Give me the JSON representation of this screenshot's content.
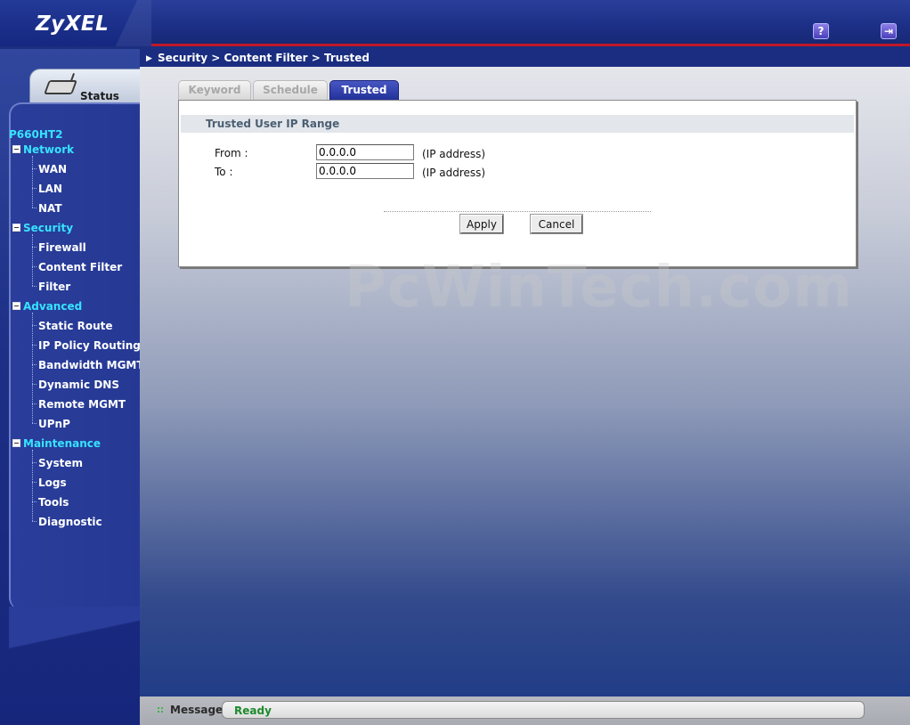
{
  "header": {
    "logo": "ZyXEL",
    "help_icon": "help-icon",
    "logout_icon": "logout-icon"
  },
  "sidebar": {
    "status_label": "Status",
    "model": "P660HT2",
    "groups": [
      {
        "label": "Network",
        "items": [
          "WAN",
          "LAN",
          "NAT"
        ]
      },
      {
        "label": "Security",
        "items": [
          "Firewall",
          "Content Filter",
          "Filter"
        ]
      },
      {
        "label": "Advanced",
        "items": [
          "Static Route",
          "IP Policy Routing",
          "Bandwidth MGMT",
          "Dynamic DNS",
          "Remote MGMT",
          "UPnP"
        ]
      },
      {
        "label": "Maintenance",
        "items": [
          "System",
          "Logs",
          "Tools",
          "Diagnostic"
        ]
      }
    ]
  },
  "breadcrumb": "Security > Content Filter > Trusted",
  "tabs": [
    {
      "label": "Keyword",
      "active": false
    },
    {
      "label": "Schedule",
      "active": false
    },
    {
      "label": "Trusted",
      "active": true
    }
  ],
  "form": {
    "section_title": "Trusted User IP Range",
    "from_label": "From :",
    "from_value": "0.0.0.0",
    "to_label": "To :",
    "to_value": "0.0.0.0",
    "hint": "(IP address)",
    "apply_label": "Apply",
    "cancel_label": "Cancel"
  },
  "watermark": "PcWinTech.com",
  "statusbar": {
    "label": "Message",
    "text": "Ready"
  },
  "colors": {
    "accent": "#1c2f86",
    "menu_group": "#37e3ff",
    "status_ok": "#1d8a2c",
    "header_rule": "#c0172a"
  }
}
